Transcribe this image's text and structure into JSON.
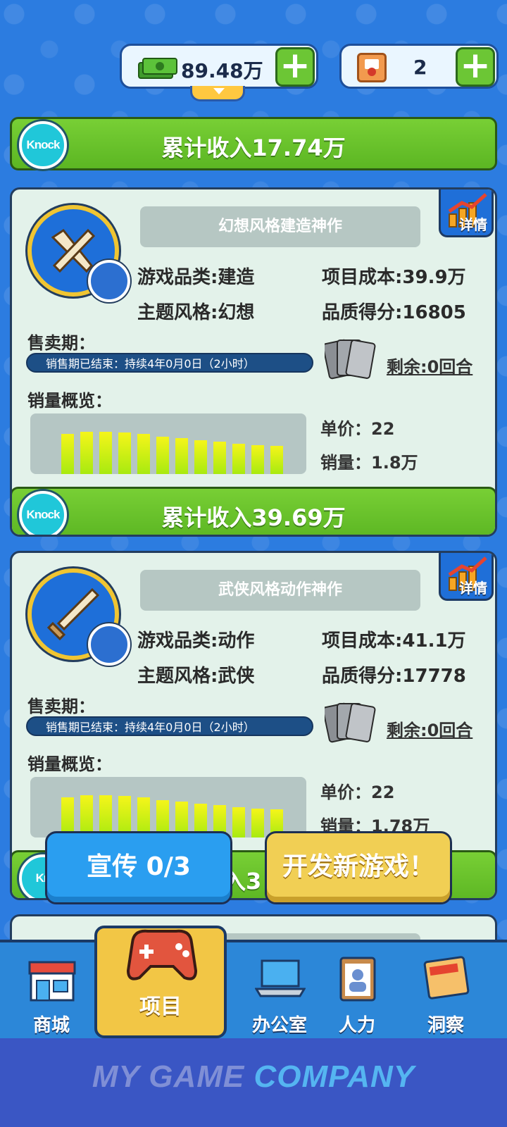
{
  "topbar": {
    "money": "89.48万",
    "mail_count": "2"
  },
  "top_revenue": {
    "knock": "Knock",
    "label": "累计收入17.74万"
  },
  "cards": [
    {
      "name": "幻想风格建造神作",
      "details": "详情",
      "genre": "游戏品类:建造",
      "theme": "主题风格:幻想",
      "cost": "项目成本:39.9万",
      "quality": "品质得分:16805",
      "sale_period_label": "售卖期：",
      "sale_status": "销售期已结束：持续4年0月0日（2小时）",
      "remaining": "剩余:0回合",
      "sales_overview_label": "销量概览：",
      "unit_price": "单价：22",
      "sales_volume": "销量：1.8万",
      "revenue": "累计收入39.69万",
      "knock": "Knock",
      "bars": [
        0.95,
        1.0,
        1.0,
        0.98,
        0.95,
        0.88,
        0.85,
        0.8,
        0.76,
        0.72,
        0.68,
        0.66
      ]
    },
    {
      "name": "武侠风格动作神作",
      "details": "详情",
      "genre": "游戏品类:动作",
      "theme": "主题风格:武侠",
      "cost": "项目成本:41.1万",
      "quality": "品质得分:17778",
      "sale_period_label": "售卖期：",
      "sale_status": "销售期已结束：持续4年0月0日（2小时）",
      "remaining": "剩余:0回合",
      "sales_overview_label": "销量概览：",
      "unit_price": "单价：22",
      "sales_volume": "销量：1.78万",
      "knock": "Kn",
      "revenue_partial": "入3",
      "bars": [
        0.95,
        1.0,
        1.0,
        0.98,
        0.95,
        0.88,
        0.85,
        0.8,
        0.76,
        0.72,
        0.68,
        0.66
      ]
    }
  ],
  "buttons": {
    "promo": "宣传 0/3",
    "new_game": "开发新游戏！"
  },
  "nav": [
    {
      "label": "商城",
      "icon": "shop-icon"
    },
    {
      "label": "项目",
      "icon": "gamepad-icon"
    },
    {
      "label": "办公室",
      "icon": "laptop-icon"
    },
    {
      "label": "人力",
      "icon": "clipboard-icon"
    },
    {
      "label": "洞察",
      "icon": "news-icon"
    }
  ],
  "footer": {
    "logo_a": "MY GAME ",
    "logo_b": "COMPANY"
  }
}
